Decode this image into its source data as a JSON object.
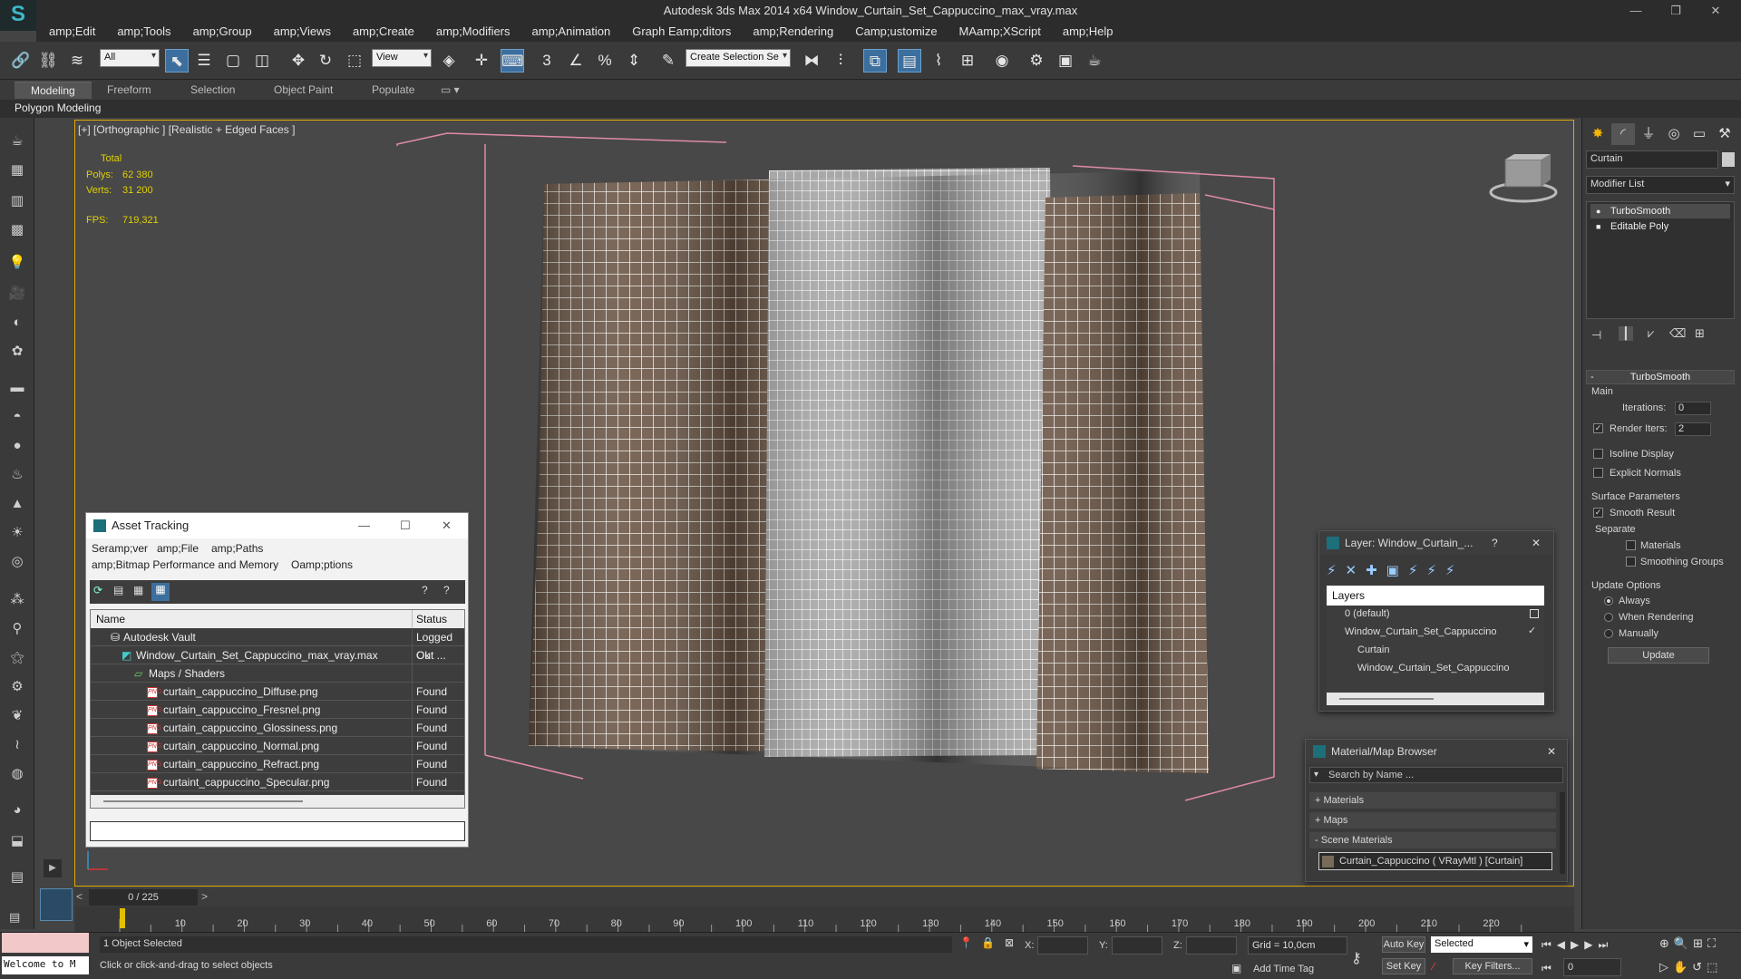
{
  "titlebar": {
    "title": "Autodesk 3ds Max  2014 x64     Window_Curtain_Set_Cappuccino_max_vray.max"
  },
  "menubar": [
    "amp;Edit",
    "amp;Tools",
    "amp;Group",
    "amp;Views",
    "amp;Create",
    "amp;Modifiers",
    "amp;Animation",
    "Graph Eamp;ditors",
    "amp;Rendering",
    "Camp;ustomize",
    "MAamp;XScript",
    "amp;Help"
  ],
  "toolbar": {
    "filter": "All",
    "refcoord": "View",
    "selection_set": "Create Selection Se"
  },
  "ribbon": {
    "tabs": [
      "Modeling",
      "Freeform",
      "Selection",
      "Object Paint",
      "Populate"
    ],
    "sub_label": "Polygon Modeling"
  },
  "viewport": {
    "label": "[+] [Orthographic ] [Realistic + Edged Faces ]",
    "stats": {
      "total_label": "Total",
      "polys_label": "Polys:",
      "polys": "62 380",
      "verts_label": "Verts:",
      "verts": "31 200",
      "fps_label": "FPS:",
      "fps": "719,321"
    }
  },
  "command_panel": {
    "object_name": "Curtain",
    "modifier_list": "Modifier List",
    "stack": [
      "TurboSmooth",
      "Editable Poly"
    ],
    "turbosmooth": {
      "title": "TurboSmooth",
      "main": "Main",
      "iterations_label": "Iterations:",
      "iterations": "0",
      "render_iters_label": "Render Iters:",
      "render_iters": "2",
      "isoline": "Isoline Display",
      "explicit": "Explicit Normals",
      "surface": "Surface Parameters",
      "smooth_result": "Smooth Result",
      "separate": "Separate",
      "materials": "Materials",
      "smoothing_groups": "Smoothing Groups",
      "update_options": "Update Options",
      "always": "Always",
      "when_rendering": "When Rendering",
      "manually": "Manually",
      "update_btn": "Update"
    }
  },
  "asset_tracking": {
    "title": "Asset Tracking",
    "menu": [
      "Seramp;ver",
      "amp;File",
      "amp;Paths",
      "amp;Bitmap Performance and Memory",
      "Oamp;ptions"
    ],
    "col_name": "Name",
    "col_status": "Status",
    "rows": [
      {
        "name": "Autodesk Vault",
        "status": "Logged Out ..."
      },
      {
        "name": "Window_Curtain_Set_Cappuccino_max_vray.max",
        "status": "Ok"
      },
      {
        "name": "Maps / Shaders",
        "status": ""
      },
      {
        "name": "curtain_cappuccino_Diffuse.png",
        "status": "Found"
      },
      {
        "name": "curtain_cappuccino_Fresnel.png",
        "status": "Found"
      },
      {
        "name": "curtain_cappuccino_Glossiness.png",
        "status": "Found"
      },
      {
        "name": "curtain_cappuccino_Normal.png",
        "status": "Found"
      },
      {
        "name": "curtain_cappuccino_Refract.png",
        "status": "Found"
      },
      {
        "name": "curtaint_cappuccino_Specular.png",
        "status": "Found"
      }
    ]
  },
  "layer_panel": {
    "title": "Layer: Window_Curtain_...",
    "header": "Layers",
    "items": [
      "0 (default)",
      "Window_Curtain_Set_Cappuccino",
      "Curtain",
      "Window_Curtain_Set_Cappuccino"
    ]
  },
  "material_browser": {
    "title": "Material/Map Browser",
    "search_placeholder": "Search by Name ...",
    "sections": [
      "+ Materials",
      "+ Maps",
      "- Scene Materials"
    ],
    "scene_item": "Curtain_Cappuccino  ( VRayMtl )  [Curtain]"
  },
  "timeline": {
    "frame": "0 / 225",
    "ticks": [
      "10",
      "20",
      "30",
      "40",
      "50",
      "60",
      "70",
      "80",
      "90",
      "100",
      "110",
      "120",
      "130",
      "140",
      "150",
      "160",
      "170",
      "180",
      "190",
      "200",
      "210",
      "220"
    ]
  },
  "statusbar": {
    "welcome": "Welcome to M",
    "selected": "1 Object Selected",
    "prompt": "Click or click-and-drag to select objects",
    "x_label": "X:",
    "y_label": "Y:",
    "z_label": "Z:",
    "grid": "Grid = 10,0cm",
    "add_time_tag": "Add Time Tag",
    "auto_key": "Auto Key",
    "selected_dd": "Selected",
    "set_key": "Set Key",
    "key_filters": "Key Filters...",
    "frame_value": "0"
  }
}
